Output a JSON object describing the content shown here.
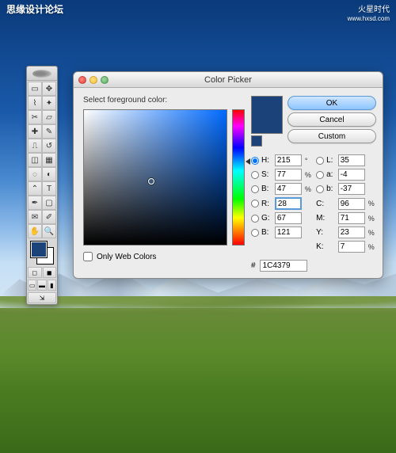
{
  "watermarks": {
    "left": "思缘设计论坛",
    "right_top": "www.hxsd.com",
    "right_icon": "火星时代"
  },
  "dialog": {
    "title": "Color Picker",
    "prompt": "Select foreground color:",
    "buttons": {
      "ok": "OK",
      "cancel": "Cancel",
      "custom": "Custom"
    },
    "only_web": "Only Web Colors",
    "hex_label": "#",
    "hex_value": "1C4379"
  },
  "hsb": {
    "h_label": "H:",
    "h_value": "215",
    "h_unit": "°",
    "s_label": "S:",
    "s_value": "77",
    "s_unit": "%",
    "b_label": "B:",
    "b_value": "47",
    "b_unit": "%"
  },
  "rgb": {
    "r_label": "R:",
    "r_value": "28",
    "g_label": "G:",
    "g_value": "67",
    "b_label": "B:",
    "b_value": "121"
  },
  "lab": {
    "l_label": "L:",
    "l_value": "35",
    "a_label": "a:",
    "a_value": "-4",
    "b_label": "b:",
    "b_value": "-37"
  },
  "cmyk": {
    "c_label": "C:",
    "c_value": "96",
    "m_label": "M:",
    "m_value": "71",
    "y_label": "Y:",
    "y_value": "23",
    "k_label": "K:",
    "k_value": "7",
    "unit": "%"
  },
  "colors": {
    "selected": "#1C4379"
  }
}
